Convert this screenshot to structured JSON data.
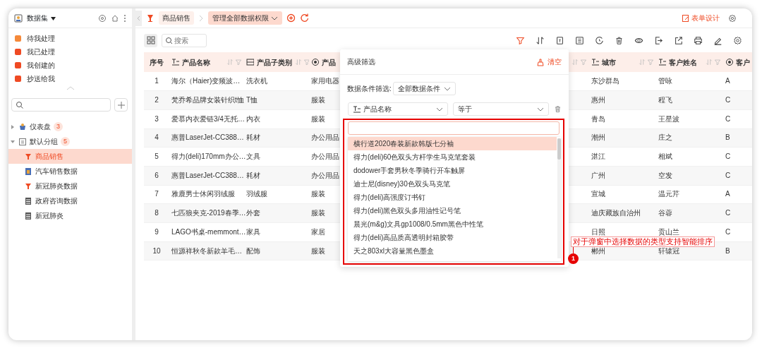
{
  "sidebar": {
    "title": "数据集",
    "tasks": [
      {
        "label": "待我处理",
        "color": "#f5893a"
      },
      {
        "label": "我已处理",
        "color": "#ef4a23"
      },
      {
        "label": "我创建的",
        "color": "#ef4a23"
      },
      {
        "label": "抄送给我",
        "color": "#ef4a23"
      }
    ],
    "tree": [
      {
        "label": "仪表盘",
        "count": "3",
        "expanded": false
      },
      {
        "label": "默认分组",
        "count": "5",
        "expanded": true,
        "children": [
          {
            "label": "商品销售",
            "kind": "chart",
            "selected": true
          },
          {
            "label": "汽车销售数据",
            "kind": "form",
            "selected": false
          },
          {
            "label": "新冠肺炎数据",
            "kind": "chart",
            "selected": false
          },
          {
            "label": "政府咨询数据",
            "kind": "sheet",
            "selected": false
          },
          {
            "label": "新冠肺炎",
            "kind": "sheet",
            "selected": false
          }
        ]
      }
    ]
  },
  "topbar": {
    "form": "商品销售",
    "view": "管理全部数据权限",
    "form_design": "表单设计"
  },
  "toolbar": {
    "search": {
      "placeholder": "搜索"
    },
    "icons": [
      {
        "kind": "filter",
        "active": true
      },
      {
        "kind": "sort",
        "active": false
      },
      {
        "kind": "document",
        "active": false
      },
      {
        "kind": "list",
        "active": false
      },
      {
        "kind": "clock",
        "active": false
      },
      {
        "kind": "trash",
        "active": false
      },
      {
        "kind": "eye",
        "active": false
      },
      {
        "kind": "import",
        "active": false
      },
      {
        "kind": "export",
        "active": false
      },
      {
        "kind": "printer",
        "active": false
      },
      {
        "kind": "pencil",
        "active": false
      },
      {
        "kind": "settings",
        "active": false
      }
    ]
  },
  "table": {
    "columns": [
      {
        "label": "序号",
        "kind": "index"
      },
      {
        "label": "产品名称",
        "kind": "text"
      },
      {
        "label": "产品子类别",
        "kind": "select"
      },
      {
        "label": "产品",
        "kind": "radio"
      },
      {
        "label": "城市",
        "kind": "text"
      },
      {
        "label": "客户姓名",
        "kind": "text"
      },
      {
        "label": "客户",
        "kind": "radio"
      }
    ],
    "rows": [
      [
        "1",
        "海尔（Haier)变频波…",
        "洗衣机",
        "家用电器",
        "东沙群岛",
        "管咏",
        "A"
      ],
      [
        "2",
        "梵乔希品牌女装针织t恤",
        "T恤",
        "服装",
        "惠州",
        "程飞",
        "C"
      ],
      [
        "3",
        "爱慕内衣爱链3/4无托…",
        "内衣",
        "服装",
        "青岛",
        "王星波",
        "C"
      ],
      [
        "4",
        "惠普LaserJet-CC388…",
        "耗材",
        "办公用品",
        "潮州",
        "庄之",
        "B"
      ],
      [
        "5",
        "得力(deli)170mm办公…",
        "文具",
        "办公用品",
        "湛江",
        "相斌",
        "C"
      ],
      [
        "6",
        "惠普LaserJet-CC388…",
        "耗材",
        "办公用品",
        "广州",
        "空发",
        "C"
      ],
      [
        "7",
        "雅鹿男士休闲羽绒服",
        "羽绒服",
        "服装",
        "宣城",
        "温元芹",
        "A"
      ],
      [
        "8",
        "七匹狼夹克-2019春季…",
        "外套",
        "服装",
        "迪庆藏族自治州",
        "谷蓉",
        "C"
      ],
      [
        "9",
        "LAGO书桌-memmont…",
        "家具",
        "家居",
        "日照",
        "贡山兰",
        "C"
      ],
      [
        "10",
        "恒源祥秋冬新款羊毛…",
        "配饰",
        "服装",
        "郴州",
        "轩辕冠",
        "B"
      ]
    ]
  },
  "filter_popup": {
    "title": "高级筛选",
    "clear": "清空",
    "condition_label": "数据条件筛选:",
    "condition_value": "全部数据条件",
    "field": "产品名称",
    "operator": "等于",
    "options": [
      {
        "label": "横行道2020春装新款韩版七分袖",
        "selected": true
      },
      {
        "label": "得力(deli)60色双头方杆学生马克笔套装",
        "selected": false
      },
      {
        "label": "dodower手套男秋冬季骑行开车触屏",
        "selected": false
      },
      {
        "label": "迪士尼(disney)30色双头马克笔",
        "selected": false
      },
      {
        "label": "得力(deli)高强度订书钉",
        "selected": false
      },
      {
        "label": "得力(deli)黑色双头多用油性记号笔",
        "selected": false
      },
      {
        "label": "晨光(m&g)文具gp1008/0.5mm黑色中性笔",
        "selected": false
      },
      {
        "label": "得力(deli)高品质高透明封箱胶带",
        "selected": false
      },
      {
        "label": "天之803xl大容量黑色墨盒",
        "selected": false
      }
    ]
  },
  "annotation": {
    "text": "对于弹窗中选择数据的类型支持智能排序",
    "number": "1"
  }
}
